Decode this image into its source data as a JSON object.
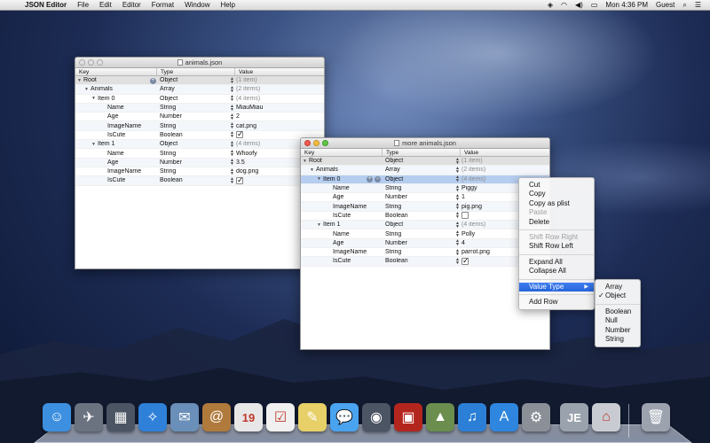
{
  "menubar": {
    "app_name": "JSON Editor",
    "menus": [
      "File",
      "Edit",
      "Editor",
      "Format",
      "Window",
      "Help"
    ],
    "clock": "Mon 4:36 PM",
    "user": "Guest"
  },
  "columns": {
    "key": "Key",
    "type": "Type",
    "value": "Value"
  },
  "window1": {
    "title": "animals.json",
    "rows": [
      {
        "key": "Root",
        "type": "Object",
        "value": "(1 item)"
      },
      {
        "key": "Animals",
        "type": "Array",
        "value": "(2 items)"
      },
      {
        "key": "Item 0",
        "type": "Object",
        "value": "(4 items)"
      },
      {
        "key": "Name",
        "type": "String",
        "value": "MiauMiau"
      },
      {
        "key": "Age",
        "type": "Number",
        "value": "2"
      },
      {
        "key": "ImageName",
        "type": "String",
        "value": "cat.png"
      },
      {
        "key": "IsCute",
        "type": "Boolean",
        "value": "",
        "checked": true
      },
      {
        "key": "Item 1",
        "type": "Object",
        "value": "(4 items)"
      },
      {
        "key": "Name",
        "type": "String",
        "value": "Whoofy"
      },
      {
        "key": "Age",
        "type": "Number",
        "value": "3.5"
      },
      {
        "key": "ImageName",
        "type": "String",
        "value": "dog.png"
      },
      {
        "key": "IsCute",
        "type": "Boolean",
        "value": "",
        "checked": true
      }
    ]
  },
  "window2": {
    "title": "more animals.json",
    "rows": [
      {
        "key": "Root",
        "type": "Object",
        "value": "(1 item)"
      },
      {
        "key": "Animals",
        "type": "Array",
        "value": "(2 items)"
      },
      {
        "key": "Item 0",
        "type": "Object",
        "value": "(4 items)"
      },
      {
        "key": "Name",
        "type": "String",
        "value": "Piggy"
      },
      {
        "key": "Age",
        "type": "Number",
        "value": "1"
      },
      {
        "key": "ImageName",
        "type": "String",
        "value": "pig.png"
      },
      {
        "key": "IsCute",
        "type": "Boolean",
        "value": "",
        "checked": false
      },
      {
        "key": "Item 1",
        "type": "Object",
        "value": "(4 items)"
      },
      {
        "key": "Name",
        "type": "String",
        "value": "Polly"
      },
      {
        "key": "Age",
        "type": "Number",
        "value": "4"
      },
      {
        "key": "ImageName",
        "type": "String",
        "value": "parrot.png"
      },
      {
        "key": "IsCute",
        "type": "Boolean",
        "value": "",
        "checked": true
      }
    ]
  },
  "context_menu": {
    "items": [
      {
        "label": "Cut",
        "enabled": true
      },
      {
        "label": "Copy",
        "enabled": true
      },
      {
        "label": "Copy as plist",
        "enabled": true
      },
      {
        "label": "Paste",
        "enabled": false
      },
      {
        "label": "Delete",
        "enabled": true
      },
      {
        "separator": true
      },
      {
        "label": "Shift Row Right",
        "enabled": false
      },
      {
        "label": "Shift Row Left",
        "enabled": true
      },
      {
        "separator": true
      },
      {
        "label": "Expand All",
        "enabled": true
      },
      {
        "label": "Collapse All",
        "enabled": true
      },
      {
        "separator": true
      },
      {
        "label": "Value Type",
        "enabled": true,
        "submenu": true,
        "highlighted": true
      },
      {
        "separator": true
      },
      {
        "label": "Add Row",
        "enabled": true
      }
    ]
  },
  "submenu": {
    "items": [
      {
        "label": "Array"
      },
      {
        "label": "Object",
        "checked": true
      },
      {
        "separator": true
      },
      {
        "label": "Boolean"
      },
      {
        "label": "Null"
      },
      {
        "label": "Number"
      },
      {
        "label": "String"
      }
    ]
  },
  "dock": {
    "apps": [
      {
        "name": "finder-icon",
        "glyph": "☺",
        "color": "#3d8fe0"
      },
      {
        "name": "launchpad-icon",
        "glyph": "✈",
        "color": "#6b7280"
      },
      {
        "name": "mission-control-icon",
        "glyph": "▦",
        "color": "#4b5563"
      },
      {
        "name": "safari-icon",
        "glyph": "✧",
        "color": "#2f80d8"
      },
      {
        "name": "mail-icon",
        "glyph": "✉",
        "color": "#6a8fb8"
      },
      {
        "name": "contacts-icon",
        "glyph": "@",
        "color": "#b07a3c"
      },
      {
        "name": "calendar-icon",
        "glyph": "19",
        "color": "#e7e7e7"
      },
      {
        "name": "reminders-icon",
        "glyph": "☑",
        "color": "#f0f0f0"
      },
      {
        "name": "notes-icon",
        "glyph": "✎",
        "color": "#e6d067"
      },
      {
        "name": "messages-icon",
        "glyph": "💬",
        "color": "#4aa3ef"
      },
      {
        "name": "facetime-icon",
        "glyph": "◉",
        "color": "#4b5563"
      },
      {
        "name": "photo-booth-icon",
        "glyph": "▣",
        "color": "#b3261e"
      },
      {
        "name": "iphoto-icon",
        "glyph": "▲",
        "color": "#6b8e4e"
      },
      {
        "name": "itunes-icon",
        "glyph": "♫",
        "color": "#2b7fd6"
      },
      {
        "name": "app-store-icon",
        "glyph": "A",
        "color": "#2e86de"
      },
      {
        "name": "system-preferences-icon",
        "glyph": "⚙",
        "color": "#8a8f98"
      },
      {
        "name": "json-editor-icon",
        "glyph": "JE",
        "color": "#9aa3ad"
      },
      {
        "name": "documents-stack-icon",
        "glyph": "⌂",
        "color": "#c8ccd2"
      },
      {
        "name": "trash-icon",
        "glyph": "🗑",
        "color": "#9ca3af"
      }
    ]
  }
}
